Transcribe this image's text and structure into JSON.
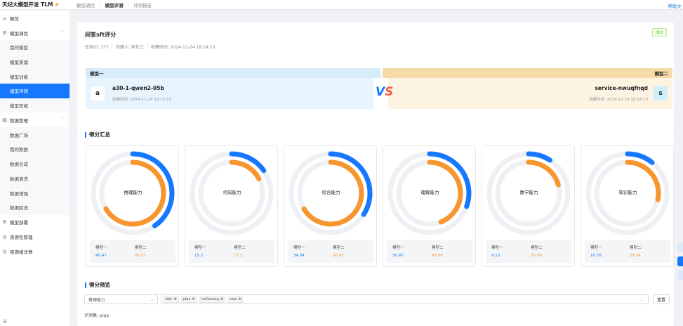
{
  "app": {
    "title": "天纪大模型开发 TLM",
    "help": "帮助文"
  },
  "breadcrumb": [
    "模型调优",
    "模型评测",
    "评测报告"
  ],
  "sidebar": {
    "overview": "概览",
    "tuning": {
      "label": "模型调优",
      "items": [
        "我的模型",
        "模型蒸馏",
        "模型训练",
        "模型评测",
        "模型压缩"
      ]
    },
    "data": {
      "label": "数据管理",
      "items": [
        "数据广场",
        "我的数据",
        "数据合成",
        "数据清洗",
        "数据增强",
        "数据回流"
      ]
    },
    "deploy": "模型部署",
    "resource": "资源包管理",
    "resource_detail": "资源组详情"
  },
  "task": {
    "title": "问答sft评分",
    "id_label": "任务ID: 377",
    "creator_label": "创建人: 周长江",
    "created_label": "创建时间: 2024-11-24 18:14:10",
    "status": "成功"
  },
  "compare": {
    "model1": {
      "header": "模型一",
      "avatar": "a",
      "name": "a30-1-qwen2-05b",
      "time": "创建时间: 2024-11-24 18:14:10"
    },
    "model2": {
      "header": "模型二",
      "avatar": "s",
      "name": "service-nwuqfnqd",
      "time": "创建时间: 2024-11-24 18:14:10"
    },
    "vs_v": "V",
    "vs_s": "S"
  },
  "scores": {
    "section_title": "得分汇总",
    "model1_label": "模型一",
    "model2_label": "模型二",
    "colors": {
      "model1": "#1677ff",
      "model2": "#f7962f",
      "track": "#eef0f4"
    },
    "cards": [
      {
        "label": "推理能力",
        "m1": "40.47",
        "m2": "66.51"
      },
      {
        "label": "代码能力",
        "m1": "15.2",
        "m2": "17.2"
      },
      {
        "label": "综合能力",
        "m1": "34.04",
        "m2": "66.42"
      },
      {
        "label": "理解能力",
        "m1": "30.47",
        "m2": "43.98"
      },
      {
        "label": "数学能力",
        "m1": "9.13",
        "m2": "20.56"
      },
      {
        "label": "知识能力",
        "m1": "10.76",
        "m2": "28.34"
      }
    ]
  },
  "preview": {
    "section_title": "得分预览",
    "select_value": "推理能力",
    "tags": [
      "bbh",
      "piqa",
      "hellaswag",
      "siqa"
    ],
    "reset": "重置",
    "evalset": "评测集: piqa"
  }
}
